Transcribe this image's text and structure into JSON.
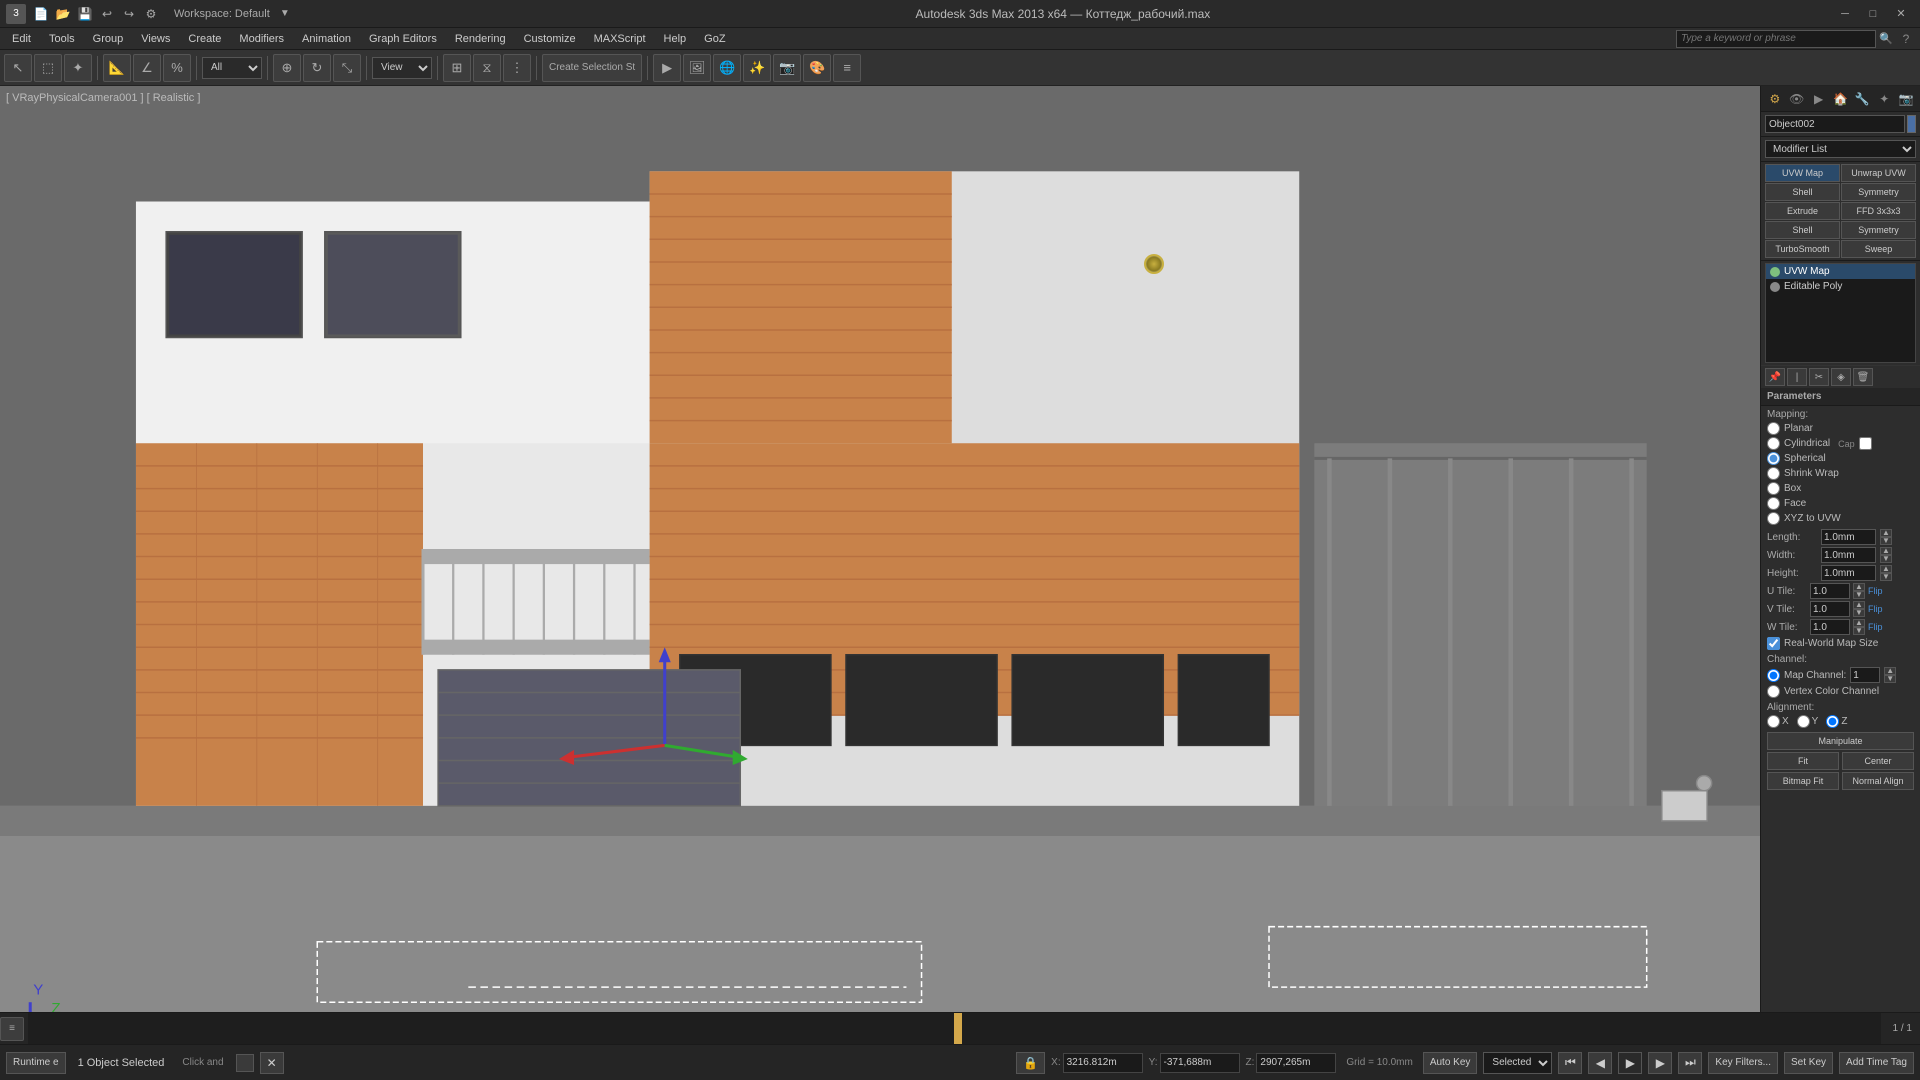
{
  "titlebar": {
    "title": "Autodesk 3ds Max 2013 x64 — Коттедж_рабочий.max",
    "workspace": "Workspace: Default"
  },
  "menu": {
    "items": [
      "Edit",
      "Tools",
      "Group",
      "Views",
      "Create",
      "Modifiers",
      "Animation",
      "Graph Editors",
      "Rendering",
      "Customize",
      "MAXScript",
      "Help",
      "GoZ"
    ]
  },
  "search": {
    "placeholder": "Type a keyword or phrase"
  },
  "viewport": {
    "label": "[ VRayPhysicalCamera001 ] [ Realistic ]",
    "frame_counter": "1 / 1"
  },
  "right_panel": {
    "object_name": "Object002",
    "modifier_list_label": "Modifier List",
    "modifiers": [
      {
        "name": "UVW Map",
        "col2": "Unwrap UVW"
      },
      {
        "name": "Shell",
        "col2": "Symmetry"
      },
      {
        "name": "Extrude",
        "col2": "FFD 3x3x3"
      },
      {
        "name": "Shell",
        "col2": "Symmetry"
      },
      {
        "name": "TurboSmooth",
        "col2": "Sweep"
      }
    ],
    "stack_items": [
      {
        "name": "UVW Map",
        "active": true,
        "selected": true
      },
      {
        "name": "Editable Poly",
        "active": false,
        "selected": false
      }
    ],
    "params": {
      "header": "Parameters",
      "mapping_label": "Mapping:",
      "mapping_options": [
        "Planar",
        "Cylindrical",
        "Cap",
        "Spherical",
        "Shrink Wrap",
        "Box",
        "Face",
        "XYZ to UVW"
      ],
      "selected_mapping": "Spherical",
      "length_label": "Length:",
      "length_value": "1.0mm",
      "width_label": "Width:",
      "width_value": "1.0mm",
      "height_label": "Height:",
      "height_value": "1.0mm",
      "u_tile_label": "U Tile:",
      "u_tile_value": "1.0",
      "v_tile_label": "V Tile:",
      "v_tile_value": "1.0",
      "w_tile_label": "W Tile:",
      "w_tile_value": "1.0",
      "flip_label": "Flip",
      "real_world_label": "Real-World Map Size",
      "channel_label": "Channel:",
      "map_channel_label": "Map Channel:",
      "map_channel_value": "1",
      "vertex_color_label": "Vertex Color Channel",
      "alignment_label": "Alignment:",
      "align_x": "X",
      "align_y": "Y",
      "align_z": "Z",
      "manipulate_btn": "Manipulate",
      "fit_btn": "Fit",
      "center_btn": "Center",
      "bitmap_fit_btn": "Bitmap Fit",
      "normal_align_btn": "Normal Align"
    }
  },
  "status_bar": {
    "object_selected": "1 Object Selected",
    "click_and": "Click and",
    "x_label": "X:",
    "x_value": "3216.812m",
    "y_label": "Y:",
    "y_value": "-371,688m",
    "z_label": "Z:",
    "z_value": "2907,265m",
    "grid_label": "Grid = 10.0mm",
    "auto_key": "Auto Key",
    "selected_label": "Selected",
    "time_tag": "Add Time Tag",
    "key_filters": "Key Filters..."
  },
  "bottom_bar": {
    "selected_option": "Selected"
  }
}
